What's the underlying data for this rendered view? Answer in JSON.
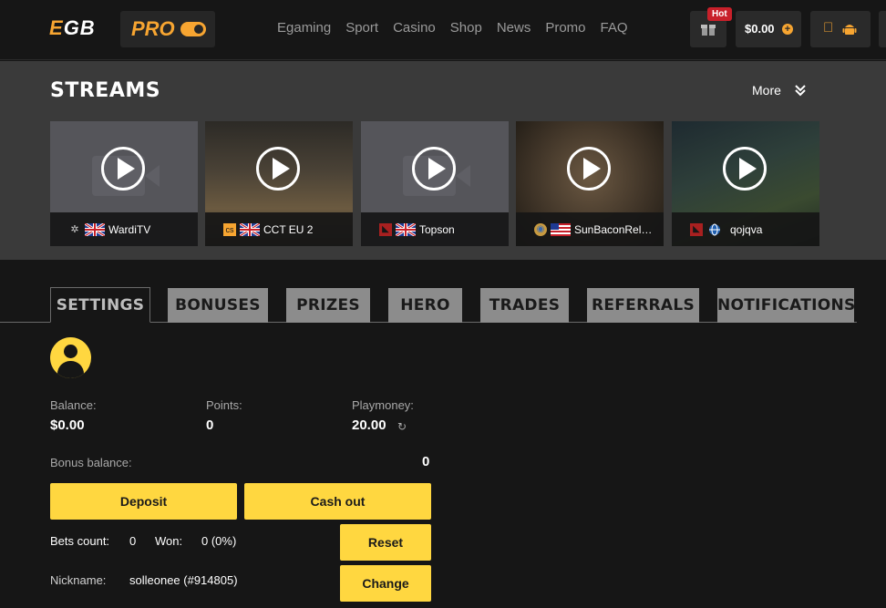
{
  "header": {
    "logo_e": "E",
    "logo_gb": "GB",
    "pro_label": "PRO",
    "nav": [
      "Egaming",
      "Sport",
      "Casino",
      "Shop",
      "News",
      "Promo",
      "FAQ"
    ],
    "hot_badge": "Hot",
    "balance": "$0.00",
    "balance_plus": "+"
  },
  "streams": {
    "title": "STREAMS",
    "more_label": "More",
    "cards": [
      {
        "name": "WardiTV",
        "game_icon": "starcraft-icon",
        "flag": "uk"
      },
      {
        "name": "CCT EU 2",
        "game_icon": "csgo-icon",
        "flag": "uk"
      },
      {
        "name": "Topson",
        "game_icon": "dota2-icon",
        "flag": "uk"
      },
      {
        "name": "SunBaconRel…",
        "game_icon": "hearthstone-icon",
        "flag": "us"
      },
      {
        "name": "qojqva",
        "game_icon": "dota2-icon",
        "flag": "globe"
      }
    ]
  },
  "tabs": [
    "SETTINGS",
    "BONUSES",
    "PRIZES",
    "HERO",
    "TRADES",
    "REFERRALS",
    "NOTIFICATIONS"
  ],
  "settings": {
    "balance_label": "Balance:",
    "balance_value": "$0.00",
    "points_label": "Points:",
    "points_value": "0",
    "playmoney_label": "Playmoney:",
    "playmoney_value": "20.00",
    "bonus_label": "Bonus balance:",
    "bonus_value": "0",
    "deposit_label": "Deposit",
    "cashout_label": "Cash out",
    "bets_count_label": "Bets count:",
    "bets_count_value": "0",
    "won_label": "Won:",
    "won_value": "0 (0%)",
    "reset_label": "Reset",
    "nickname_label": "Nickname:",
    "nickname_value": "solleonee (#914805)",
    "change_label": "Change"
  },
  "colors": {
    "accent_orange": "#f7a531",
    "button_yellow": "#ffd740",
    "hot_red": "#c8202a"
  }
}
